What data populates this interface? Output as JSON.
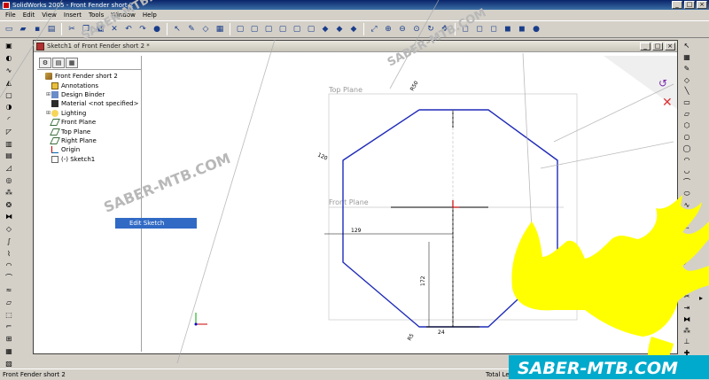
{
  "window": {
    "title": "SolidWorks 2005 - Front Fender short 2"
  },
  "menu": [
    "File",
    "Edit",
    "View",
    "Insert",
    "Tools",
    "Window",
    "Help"
  ],
  "document": {
    "title": "Sketch1 of Front Fender short 2 *"
  },
  "tree": {
    "root": "Front Fender short 2",
    "items": [
      {
        "label": "Annotations",
        "icon": "annotations-icon",
        "expandable": false
      },
      {
        "label": "Design Binder",
        "icon": "binder-icon",
        "expandable": true
      },
      {
        "label": "Material <not specified>",
        "icon": "material-icon",
        "expandable": false
      },
      {
        "label": "Lighting",
        "icon": "lighting-icon",
        "expandable": true
      },
      {
        "label": "Front Plane",
        "icon": "plane-icon",
        "expandable": false
      },
      {
        "label": "Top Plane",
        "icon": "plane-icon",
        "expandable": false
      },
      {
        "label": "Right Plane",
        "icon": "plane-icon",
        "expandable": false
      },
      {
        "label": "Origin",
        "icon": "origin-icon",
        "expandable": false
      },
      {
        "label": "(-) Sketch1",
        "icon": "sketch-icon",
        "expandable": false
      }
    ]
  },
  "context_menu": {
    "label": "Edit Sketch"
  },
  "graphics": {
    "plane_labels": {
      "top": "Top Plane",
      "front": "Front Plane"
    },
    "dimensions": {
      "d1": "R50",
      "d2": "120",
      "d3": "129",
      "d4": "172",
      "d5": "24",
      "d6": "R5"
    }
  },
  "status": {
    "left": "Front Fender short 2",
    "right": "Total Le"
  },
  "watermark": {
    "text": "SABER-MTB.COM"
  },
  "colors": {
    "sketch": "#1f2bb8",
    "titlebar": "#0a246a",
    "selection": "#316ac5",
    "logo": "#ffff00",
    "banner_text": "#ffffff"
  }
}
